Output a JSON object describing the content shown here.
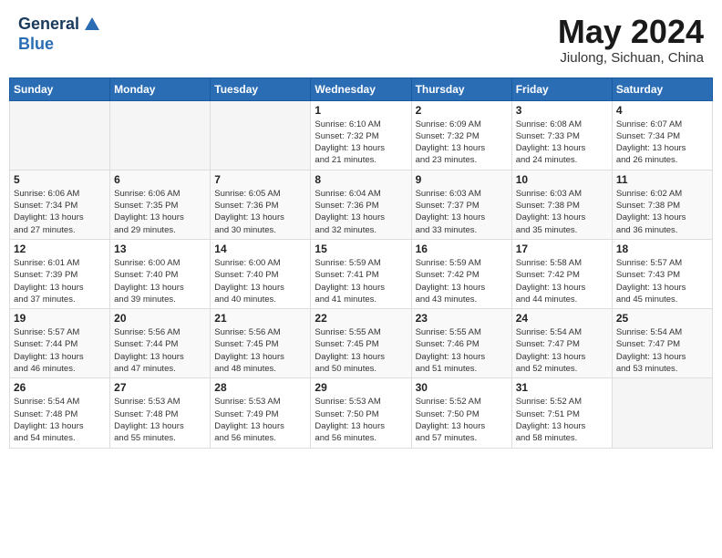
{
  "header": {
    "logo_line1": "General",
    "logo_line2": "Blue",
    "month_title": "May 2024",
    "location": "Jiulong, Sichuan, China"
  },
  "days_of_week": [
    "Sunday",
    "Monday",
    "Tuesday",
    "Wednesday",
    "Thursday",
    "Friday",
    "Saturday"
  ],
  "weeks": [
    [
      {
        "day": "",
        "info": ""
      },
      {
        "day": "",
        "info": ""
      },
      {
        "day": "",
        "info": ""
      },
      {
        "day": "1",
        "info": "Sunrise: 6:10 AM\nSunset: 7:32 PM\nDaylight: 13 hours\nand 21 minutes."
      },
      {
        "day": "2",
        "info": "Sunrise: 6:09 AM\nSunset: 7:32 PM\nDaylight: 13 hours\nand 23 minutes."
      },
      {
        "day": "3",
        "info": "Sunrise: 6:08 AM\nSunset: 7:33 PM\nDaylight: 13 hours\nand 24 minutes."
      },
      {
        "day": "4",
        "info": "Sunrise: 6:07 AM\nSunset: 7:34 PM\nDaylight: 13 hours\nand 26 minutes."
      }
    ],
    [
      {
        "day": "5",
        "info": "Sunrise: 6:06 AM\nSunset: 7:34 PM\nDaylight: 13 hours\nand 27 minutes."
      },
      {
        "day": "6",
        "info": "Sunrise: 6:06 AM\nSunset: 7:35 PM\nDaylight: 13 hours\nand 29 minutes."
      },
      {
        "day": "7",
        "info": "Sunrise: 6:05 AM\nSunset: 7:36 PM\nDaylight: 13 hours\nand 30 minutes."
      },
      {
        "day": "8",
        "info": "Sunrise: 6:04 AM\nSunset: 7:36 PM\nDaylight: 13 hours\nand 32 minutes."
      },
      {
        "day": "9",
        "info": "Sunrise: 6:03 AM\nSunset: 7:37 PM\nDaylight: 13 hours\nand 33 minutes."
      },
      {
        "day": "10",
        "info": "Sunrise: 6:03 AM\nSunset: 7:38 PM\nDaylight: 13 hours\nand 35 minutes."
      },
      {
        "day": "11",
        "info": "Sunrise: 6:02 AM\nSunset: 7:38 PM\nDaylight: 13 hours\nand 36 minutes."
      }
    ],
    [
      {
        "day": "12",
        "info": "Sunrise: 6:01 AM\nSunset: 7:39 PM\nDaylight: 13 hours\nand 37 minutes."
      },
      {
        "day": "13",
        "info": "Sunrise: 6:00 AM\nSunset: 7:40 PM\nDaylight: 13 hours\nand 39 minutes."
      },
      {
        "day": "14",
        "info": "Sunrise: 6:00 AM\nSunset: 7:40 PM\nDaylight: 13 hours\nand 40 minutes."
      },
      {
        "day": "15",
        "info": "Sunrise: 5:59 AM\nSunset: 7:41 PM\nDaylight: 13 hours\nand 41 minutes."
      },
      {
        "day": "16",
        "info": "Sunrise: 5:59 AM\nSunset: 7:42 PM\nDaylight: 13 hours\nand 43 minutes."
      },
      {
        "day": "17",
        "info": "Sunrise: 5:58 AM\nSunset: 7:42 PM\nDaylight: 13 hours\nand 44 minutes."
      },
      {
        "day": "18",
        "info": "Sunrise: 5:57 AM\nSunset: 7:43 PM\nDaylight: 13 hours\nand 45 minutes."
      }
    ],
    [
      {
        "day": "19",
        "info": "Sunrise: 5:57 AM\nSunset: 7:44 PM\nDaylight: 13 hours\nand 46 minutes."
      },
      {
        "day": "20",
        "info": "Sunrise: 5:56 AM\nSunset: 7:44 PM\nDaylight: 13 hours\nand 47 minutes."
      },
      {
        "day": "21",
        "info": "Sunrise: 5:56 AM\nSunset: 7:45 PM\nDaylight: 13 hours\nand 48 minutes."
      },
      {
        "day": "22",
        "info": "Sunrise: 5:55 AM\nSunset: 7:45 PM\nDaylight: 13 hours\nand 50 minutes."
      },
      {
        "day": "23",
        "info": "Sunrise: 5:55 AM\nSunset: 7:46 PM\nDaylight: 13 hours\nand 51 minutes."
      },
      {
        "day": "24",
        "info": "Sunrise: 5:54 AM\nSunset: 7:47 PM\nDaylight: 13 hours\nand 52 minutes."
      },
      {
        "day": "25",
        "info": "Sunrise: 5:54 AM\nSunset: 7:47 PM\nDaylight: 13 hours\nand 53 minutes."
      }
    ],
    [
      {
        "day": "26",
        "info": "Sunrise: 5:54 AM\nSunset: 7:48 PM\nDaylight: 13 hours\nand 54 minutes."
      },
      {
        "day": "27",
        "info": "Sunrise: 5:53 AM\nSunset: 7:48 PM\nDaylight: 13 hours\nand 55 minutes."
      },
      {
        "day": "28",
        "info": "Sunrise: 5:53 AM\nSunset: 7:49 PM\nDaylight: 13 hours\nand 56 minutes."
      },
      {
        "day": "29",
        "info": "Sunrise: 5:53 AM\nSunset: 7:50 PM\nDaylight: 13 hours\nand 56 minutes."
      },
      {
        "day": "30",
        "info": "Sunrise: 5:52 AM\nSunset: 7:50 PM\nDaylight: 13 hours\nand 57 minutes."
      },
      {
        "day": "31",
        "info": "Sunrise: 5:52 AM\nSunset: 7:51 PM\nDaylight: 13 hours\nand 58 minutes."
      },
      {
        "day": "",
        "info": ""
      }
    ]
  ]
}
